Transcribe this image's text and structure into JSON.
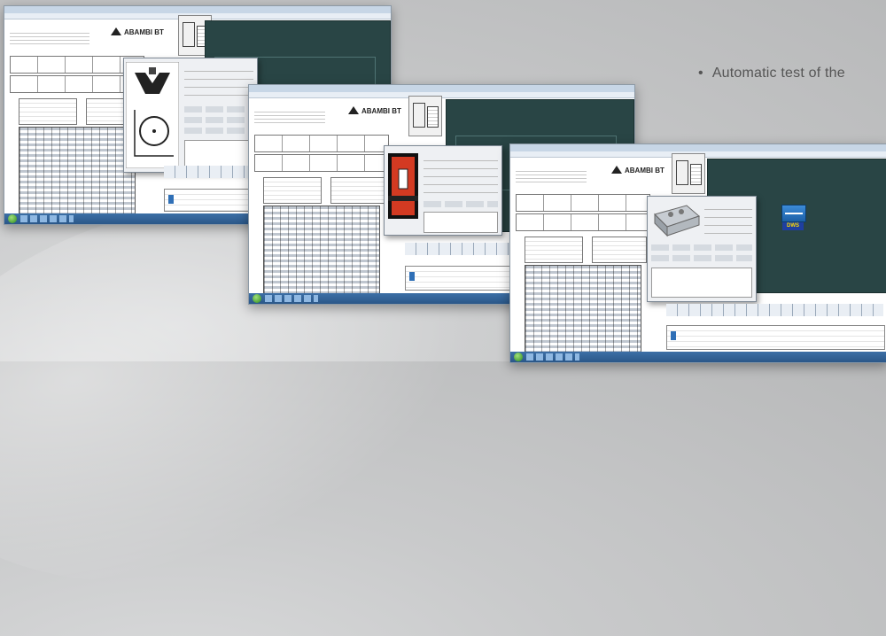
{
  "caption": {
    "bullet": "•",
    "text": "Automatic test of the"
  },
  "windows": [
    {
      "name": "screenshot-1",
      "logo_text": "ABAMBI BT",
      "dialog_graphic": "v-block-and-circle-diagram-icon"
    },
    {
      "name": "screenshot-2",
      "logo_text": "ABAMBI BT",
      "dialog_graphic": "red-clamp-icon"
    },
    {
      "name": "screenshot-3",
      "logo_text": "ABAMBI BT",
      "dialog_graphic": "gripper-icon",
      "app_icon_label": "DWS"
    }
  ],
  "colors": {
    "background": "#c9cacb",
    "dark_panel": "#294545",
    "taskbar": "#2b5788",
    "caption_text": "#555555"
  }
}
